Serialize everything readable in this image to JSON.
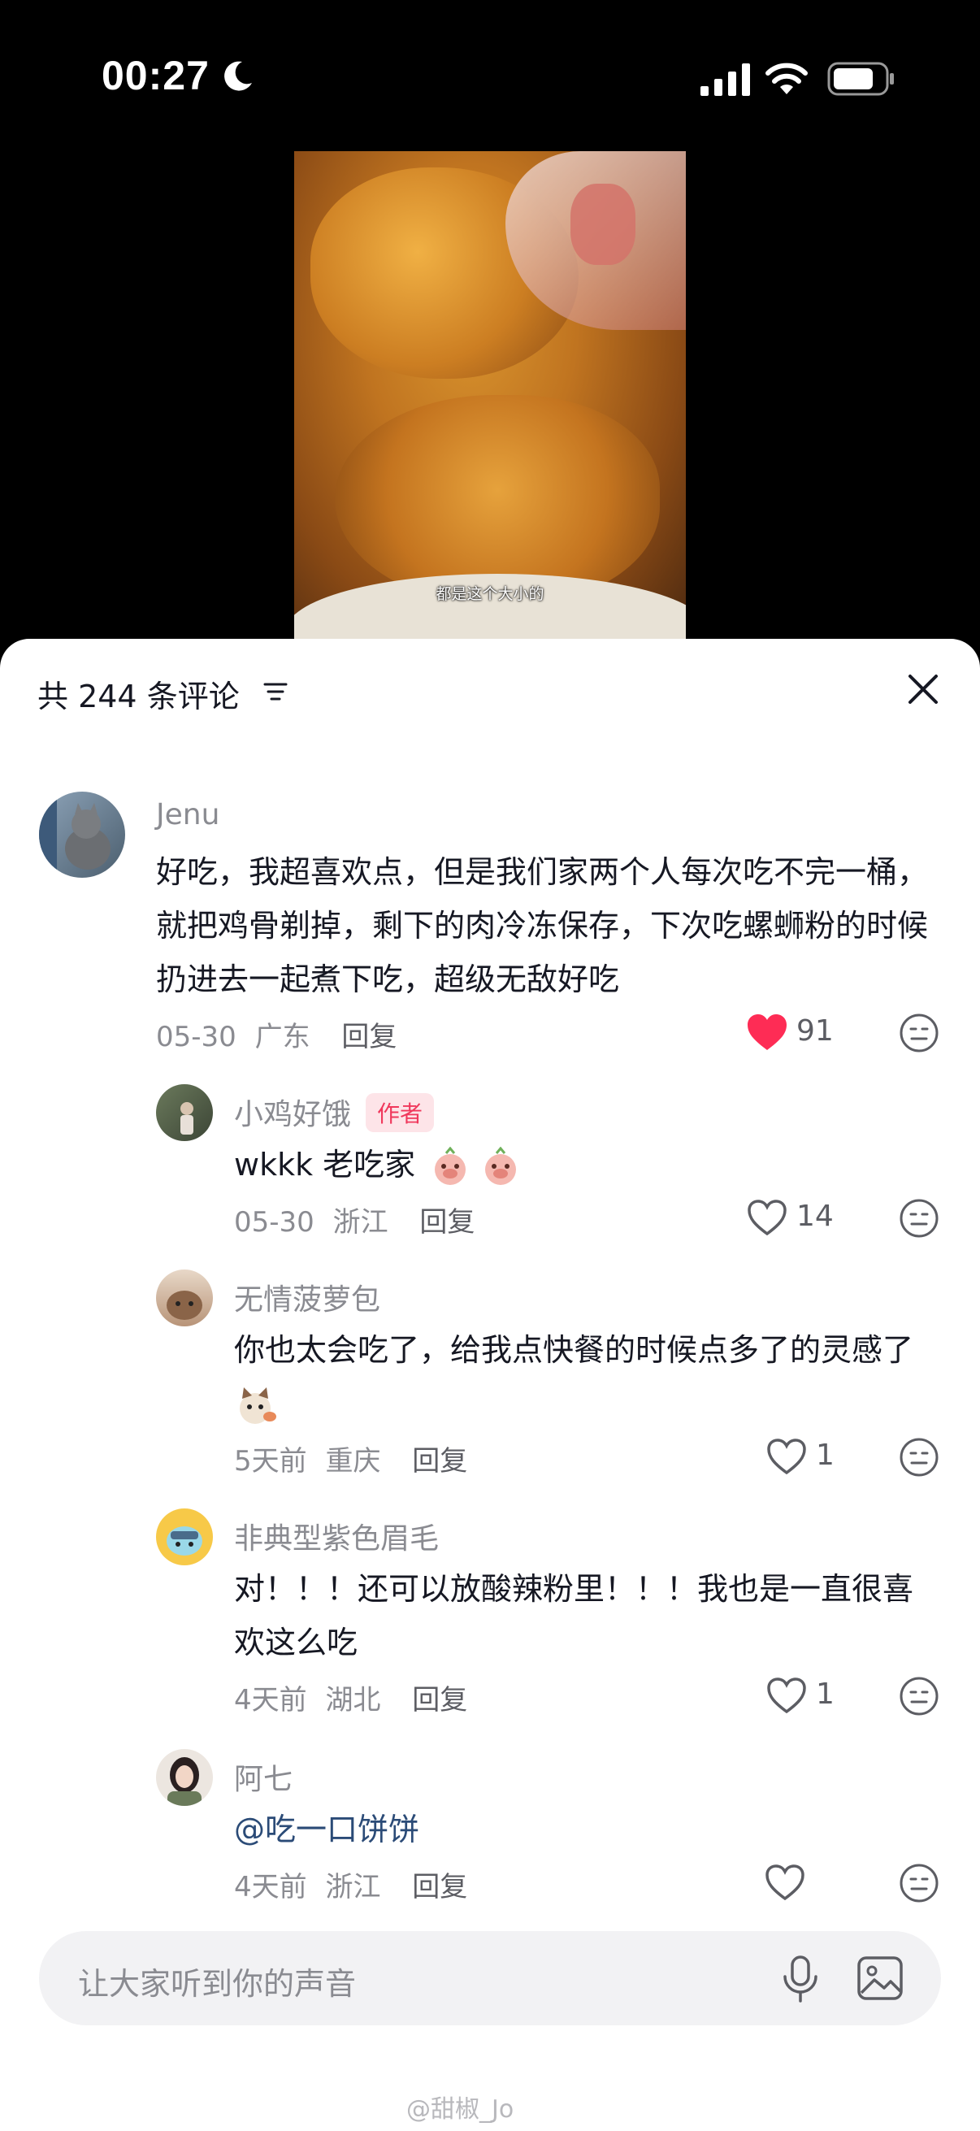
{
  "status_bar": {
    "time": "00:27"
  },
  "video": {
    "subtitle": "都是这个大小的"
  },
  "comments_panel": {
    "title": "共 244 条评论",
    "comments": [
      {
        "name": "Jenu",
        "text": "好吃，我超喜欢点，但是我们家两个人每次吃不完一桶，就把鸡骨剃掉，剩下的肉冷冻保存，下次吃螺蛳粉的时候扔进去一起煮下吃，超级无敌好吃",
        "date": "05-30",
        "location": "广东",
        "reply": "回复",
        "likes": "91",
        "liked": true
      }
    ],
    "replies": [
      {
        "name": "小鸡好饿",
        "badge": "作者",
        "text": "wkkk 老吃家",
        "date": "05-30",
        "location": "浙江",
        "reply": "回复",
        "likes": "14"
      },
      {
        "name": "无情菠萝包",
        "text": "你也太会吃了，给我点快餐的时候点多了的灵感了",
        "date": "5天前",
        "location": "重庆",
        "reply": "回复",
        "likes": "1"
      },
      {
        "name": "非典型紫色眉毛",
        "text": "对！！！还可以放酸辣粉里！！！我也是一直很喜欢这么吃",
        "date": "4天前",
        "location": "湖北",
        "reply": "回复",
        "likes": "1"
      },
      {
        "name": "阿七",
        "text": "@吃一口饼饼",
        "date": "4天前",
        "location": "浙江",
        "reply": "回复",
        "likes": ""
      }
    ]
  },
  "input": {
    "placeholder": "让大家听到你的声音"
  },
  "watermark": "@甜椒_Jo",
  "colors": {
    "like_red": "#fe2c55",
    "sheet_bg": "#ffffff",
    "muted_text": "#8a8b91"
  }
}
